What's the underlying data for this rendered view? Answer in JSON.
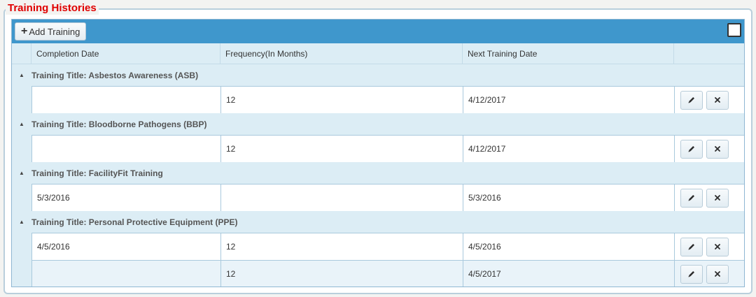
{
  "panel": {
    "title": "Training Histories"
  },
  "toolbar": {
    "add_label": "Add Training",
    "add_icon": "plus-icon"
  },
  "columns": {
    "completion": "Completion Date",
    "frequency": "Frequency(In Months)",
    "next": "Next Training Date"
  },
  "groups": [
    {
      "title": "Training Title: Asbestos Awareness (ASB)",
      "rows": [
        {
          "completion": "",
          "frequency": "12",
          "next": "4/12/2017"
        }
      ]
    },
    {
      "title": "Training Title: Bloodborne Pathogens (BBP)",
      "rows": [
        {
          "completion": "",
          "frequency": "12",
          "next": "4/12/2017"
        }
      ]
    },
    {
      "title": "Training Title: FacilityFit Training",
      "rows": [
        {
          "completion": "5/3/2016",
          "frequency": "",
          "next": "5/3/2016"
        }
      ]
    },
    {
      "title": "Training Title: Personal Protective Equipment (PPE)",
      "rows": [
        {
          "completion": "4/5/2016",
          "frequency": "12",
          "next": "4/5/2016"
        },
        {
          "completion": "",
          "frequency": "12",
          "next": "4/5/2017"
        }
      ]
    }
  ],
  "colors": {
    "legend": "#e00000",
    "toolbar": "#3f97cc",
    "group_bg": "#dcedf5",
    "alt_row": "#e9f3f9",
    "border": "#a9c9dd"
  }
}
